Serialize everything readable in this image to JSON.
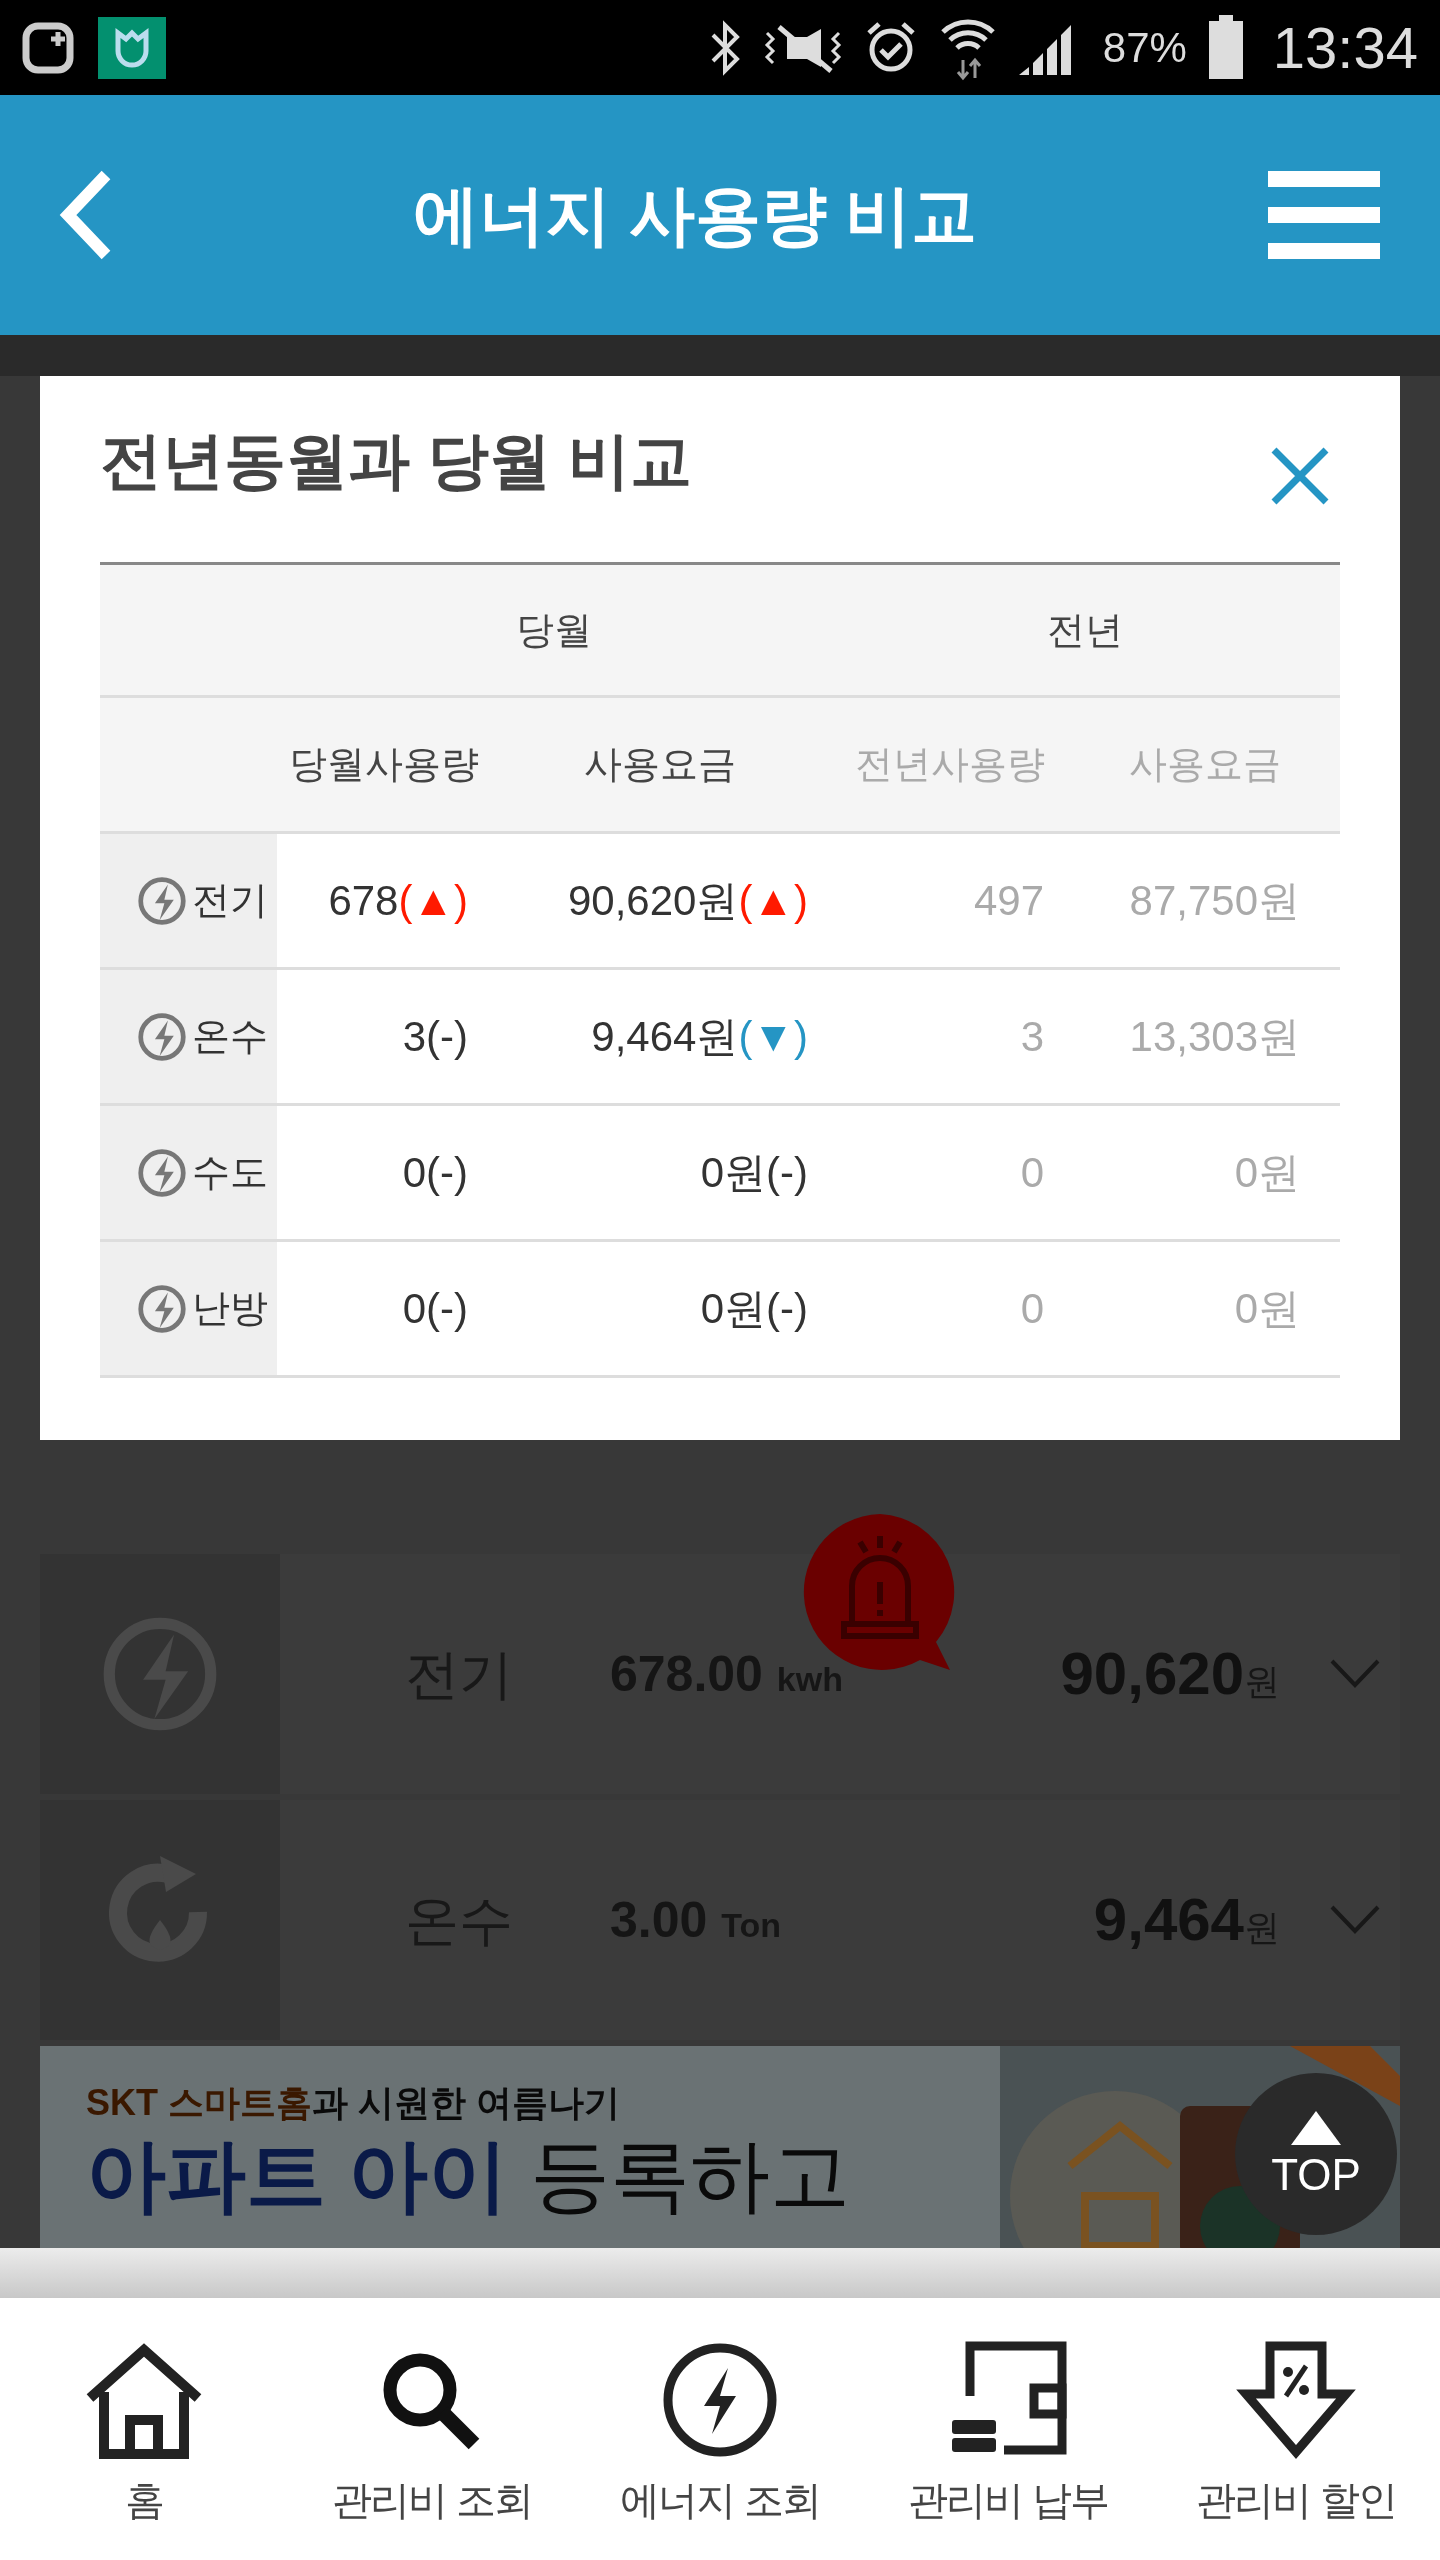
{
  "status_bar": {
    "battery": "87%",
    "time": "13:34"
  },
  "header": {
    "title": "에너지 사용량 비교"
  },
  "modal": {
    "title": "전년동월과 당월 비교",
    "group_headers": [
      "당월",
      "전년"
    ],
    "columns": [
      {
        "label": "당월사용량",
        "muted": false
      },
      {
        "label": "사용요금",
        "muted": false
      },
      {
        "label": "전년사용량",
        "muted": true
      },
      {
        "label": "사용요금",
        "muted": true
      }
    ],
    "rows": [
      {
        "label": "전기",
        "current": [
          {
            "value": "678",
            "mark": "(▲)",
            "color": "#ff1a00"
          },
          {
            "value": "90,620원",
            "mark": "(▲)",
            "color": "#ff1a00"
          }
        ],
        "previous": [
          "497",
          "87,750원"
        ]
      },
      {
        "label": "온수",
        "current": [
          {
            "value": "3",
            "mark": "(-)",
            "color": "#333333"
          },
          {
            "value": "9,464원",
            "mark": "(▼)",
            "color": "#2595c4"
          }
        ],
        "previous": [
          "3",
          "13,303원"
        ]
      },
      {
        "label": "수도",
        "current": [
          {
            "value": "0",
            "mark": "(-)",
            "color": "#333333"
          },
          {
            "value": "0원",
            "mark": "(-)",
            "color": "#333333"
          }
        ],
        "previous": [
          "0",
          "0원"
        ]
      },
      {
        "label": "난방",
        "current": [
          {
            "value": "0",
            "mark": "(-)",
            "color": "#333333"
          },
          {
            "value": "0원",
            "mark": "(-)",
            "color": "#333333"
          }
        ],
        "previous": [
          "0",
          "0원"
        ]
      }
    ]
  },
  "usage_list": [
    {
      "kind": "electric",
      "name": "전기",
      "amount": "678.00",
      "unit": "kwh",
      "price": "90,620",
      "currency": "원",
      "alert": true
    },
    {
      "kind": "water",
      "name": "온수",
      "amount": "3.00",
      "unit": "Ton",
      "price": "9,464",
      "currency": "원",
      "alert": false
    }
  ],
  "banner": {
    "kind": "picture",
    "line_1": [
      {
        "text": "SKT 스마트홈",
        "accent": true
      },
      {
        "text": "과 시원한 여름나기",
        "accent": false
      }
    ],
    "line_2": [
      {
        "text": "아파트 아이",
        "accent": true
      },
      {
        "text": " 등록하고",
        "accent": false
      }
    ]
  },
  "top_button": "TOP",
  "bottom_nav": [
    {
      "kind": "home",
      "label": "홈"
    },
    {
      "kind": "search",
      "label": "관리비 조회"
    },
    {
      "kind": "energy",
      "label": "에너지 조회"
    },
    {
      "kind": "payment",
      "label": "관리비 납부"
    },
    {
      "kind": "discount",
      "label": "관리비 할인"
    }
  ]
}
